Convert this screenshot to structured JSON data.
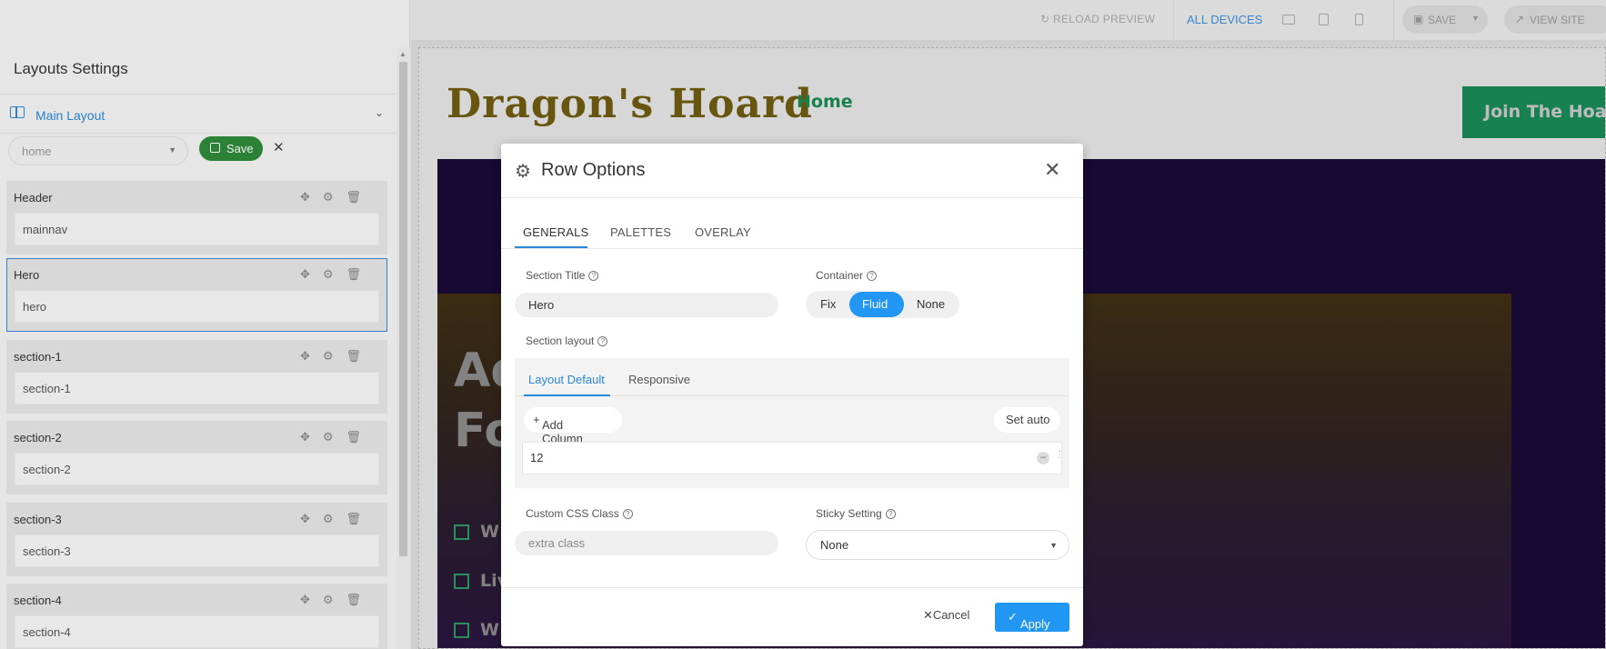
{
  "sidebar": {
    "title": "Layouts Settings",
    "layout_name": "Main Layout",
    "page_select": "home",
    "save_label": "Save",
    "cards": [
      {
        "name": "Header",
        "value": "mainnav"
      },
      {
        "name": "Hero",
        "value": "hero"
      },
      {
        "name": "section-1",
        "value": "section-1"
      },
      {
        "name": "section-2",
        "value": "section-2"
      },
      {
        "name": "section-3",
        "value": "section-3"
      },
      {
        "name": "section-4",
        "value": "section-4"
      }
    ]
  },
  "toolbar": {
    "reload": "RELOAD PREVIEW",
    "all_devices": "ALL DEVICES",
    "save": "SAVE",
    "view_site": "VIEW SITE"
  },
  "preview": {
    "logo": "Dragon's Hoard",
    "nav_home": "Home",
    "cta": "Join The Hoard",
    "hero_lines": [
      "Ad",
      "Fo"
    ],
    "bullets": [
      "W",
      "Liv",
      "W"
    ]
  },
  "modal": {
    "title": "Row Options",
    "tabs": [
      "GENERALS",
      "PALETTES",
      "OVERLAY"
    ],
    "section_title_label": "Section Title",
    "section_title_value": "Hero",
    "container_label": "Container",
    "container_options": [
      "Fix",
      "Fluid",
      "None"
    ],
    "container_selected": "Fluid",
    "section_layout_label": "Section layout",
    "layout_tabs": [
      "Layout Default",
      "Responsive"
    ],
    "add_column": "Add Column",
    "set_auto": "Set auto",
    "column_value": "12",
    "custom_css_label": "Custom CSS Class",
    "custom_css_placeholder": "extra class",
    "sticky_label": "Sticky Setting",
    "sticky_value": "None",
    "cancel": "Cancel",
    "apply": "Apply"
  },
  "colors": {
    "accent": "#2196f3",
    "save_green": "#2e8b3a",
    "brand_green": "#1a8a57",
    "hero_purple": "#1a0a36"
  }
}
